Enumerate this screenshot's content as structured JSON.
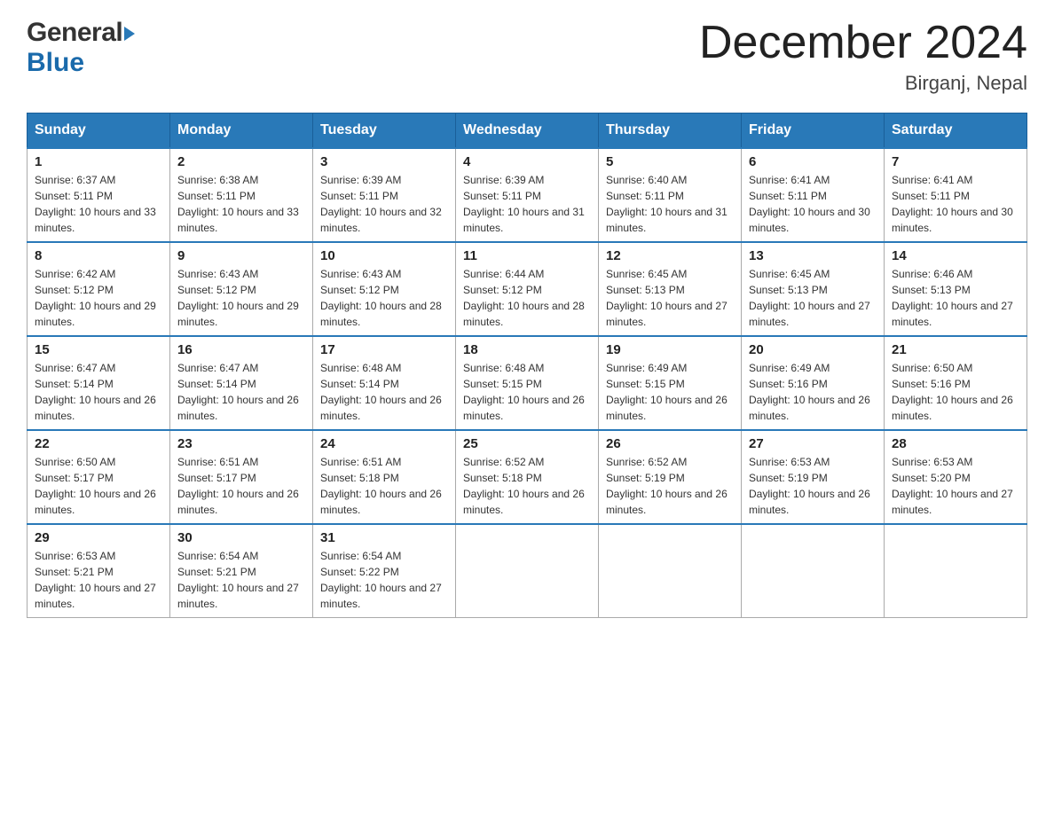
{
  "header": {
    "logo": {
      "general_text": "General",
      "blue_text": "Blue"
    },
    "title": "December 2024",
    "location": "Birganj, Nepal"
  },
  "calendar": {
    "days_of_week": [
      "Sunday",
      "Monday",
      "Tuesday",
      "Wednesday",
      "Thursday",
      "Friday",
      "Saturday"
    ],
    "weeks": [
      [
        {
          "day": "1",
          "sunrise": "6:37 AM",
          "sunset": "5:11 PM",
          "daylight": "10 hours and 33 minutes."
        },
        {
          "day": "2",
          "sunrise": "6:38 AM",
          "sunset": "5:11 PM",
          "daylight": "10 hours and 33 minutes."
        },
        {
          "day": "3",
          "sunrise": "6:39 AM",
          "sunset": "5:11 PM",
          "daylight": "10 hours and 32 minutes."
        },
        {
          "day": "4",
          "sunrise": "6:39 AM",
          "sunset": "5:11 PM",
          "daylight": "10 hours and 31 minutes."
        },
        {
          "day": "5",
          "sunrise": "6:40 AM",
          "sunset": "5:11 PM",
          "daylight": "10 hours and 31 minutes."
        },
        {
          "day": "6",
          "sunrise": "6:41 AM",
          "sunset": "5:11 PM",
          "daylight": "10 hours and 30 minutes."
        },
        {
          "day": "7",
          "sunrise": "6:41 AM",
          "sunset": "5:11 PM",
          "daylight": "10 hours and 30 minutes."
        }
      ],
      [
        {
          "day": "8",
          "sunrise": "6:42 AM",
          "sunset": "5:12 PM",
          "daylight": "10 hours and 29 minutes."
        },
        {
          "day": "9",
          "sunrise": "6:43 AM",
          "sunset": "5:12 PM",
          "daylight": "10 hours and 29 minutes."
        },
        {
          "day": "10",
          "sunrise": "6:43 AM",
          "sunset": "5:12 PM",
          "daylight": "10 hours and 28 minutes."
        },
        {
          "day": "11",
          "sunrise": "6:44 AM",
          "sunset": "5:12 PM",
          "daylight": "10 hours and 28 minutes."
        },
        {
          "day": "12",
          "sunrise": "6:45 AM",
          "sunset": "5:13 PM",
          "daylight": "10 hours and 27 minutes."
        },
        {
          "day": "13",
          "sunrise": "6:45 AM",
          "sunset": "5:13 PM",
          "daylight": "10 hours and 27 minutes."
        },
        {
          "day": "14",
          "sunrise": "6:46 AM",
          "sunset": "5:13 PM",
          "daylight": "10 hours and 27 minutes."
        }
      ],
      [
        {
          "day": "15",
          "sunrise": "6:47 AM",
          "sunset": "5:14 PM",
          "daylight": "10 hours and 26 minutes."
        },
        {
          "day": "16",
          "sunrise": "6:47 AM",
          "sunset": "5:14 PM",
          "daylight": "10 hours and 26 minutes."
        },
        {
          "day": "17",
          "sunrise": "6:48 AM",
          "sunset": "5:14 PM",
          "daylight": "10 hours and 26 minutes."
        },
        {
          "day": "18",
          "sunrise": "6:48 AM",
          "sunset": "5:15 PM",
          "daylight": "10 hours and 26 minutes."
        },
        {
          "day": "19",
          "sunrise": "6:49 AM",
          "sunset": "5:15 PM",
          "daylight": "10 hours and 26 minutes."
        },
        {
          "day": "20",
          "sunrise": "6:49 AM",
          "sunset": "5:16 PM",
          "daylight": "10 hours and 26 minutes."
        },
        {
          "day": "21",
          "sunrise": "6:50 AM",
          "sunset": "5:16 PM",
          "daylight": "10 hours and 26 minutes."
        }
      ],
      [
        {
          "day": "22",
          "sunrise": "6:50 AM",
          "sunset": "5:17 PM",
          "daylight": "10 hours and 26 minutes."
        },
        {
          "day": "23",
          "sunrise": "6:51 AM",
          "sunset": "5:17 PM",
          "daylight": "10 hours and 26 minutes."
        },
        {
          "day": "24",
          "sunrise": "6:51 AM",
          "sunset": "5:18 PM",
          "daylight": "10 hours and 26 minutes."
        },
        {
          "day": "25",
          "sunrise": "6:52 AM",
          "sunset": "5:18 PM",
          "daylight": "10 hours and 26 minutes."
        },
        {
          "day": "26",
          "sunrise": "6:52 AM",
          "sunset": "5:19 PM",
          "daylight": "10 hours and 26 minutes."
        },
        {
          "day": "27",
          "sunrise": "6:53 AM",
          "sunset": "5:19 PM",
          "daylight": "10 hours and 26 minutes."
        },
        {
          "day": "28",
          "sunrise": "6:53 AM",
          "sunset": "5:20 PM",
          "daylight": "10 hours and 27 minutes."
        }
      ],
      [
        {
          "day": "29",
          "sunrise": "6:53 AM",
          "sunset": "5:21 PM",
          "daylight": "10 hours and 27 minutes."
        },
        {
          "day": "30",
          "sunrise": "6:54 AM",
          "sunset": "5:21 PM",
          "daylight": "10 hours and 27 minutes."
        },
        {
          "day": "31",
          "sunrise": "6:54 AM",
          "sunset": "5:22 PM",
          "daylight": "10 hours and 27 minutes."
        },
        null,
        null,
        null,
        null
      ]
    ]
  }
}
